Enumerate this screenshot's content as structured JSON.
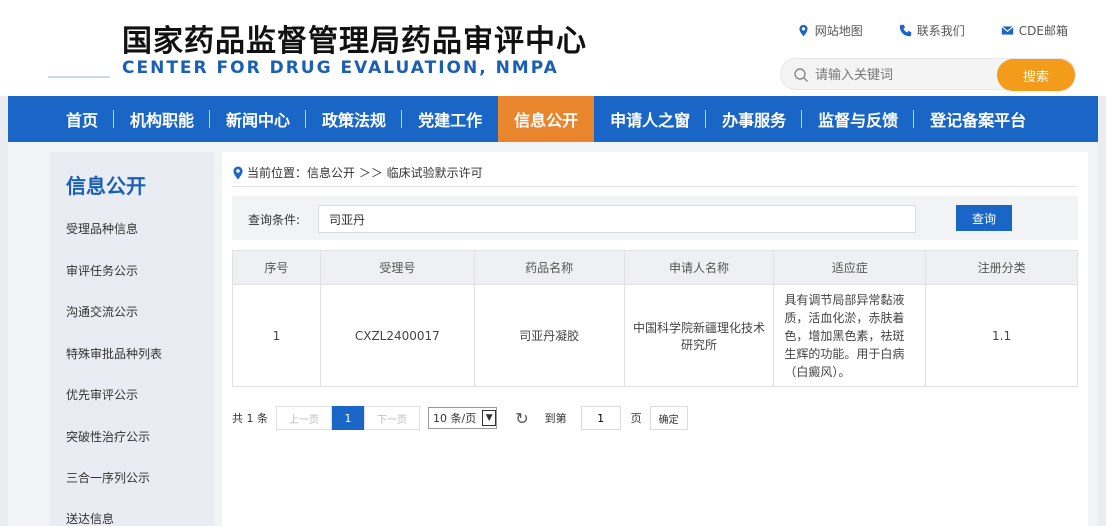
{
  "header": {
    "title_cn": "国家药品监督管理局药品审评中心",
    "title_en": "CENTER FOR DRUG EVALUATION, NMPA",
    "links": [
      {
        "icon": "location-pin-icon",
        "label": "网站地图"
      },
      {
        "icon": "phone-icon",
        "label": "联系我们"
      },
      {
        "icon": "mail-icon",
        "label": "CDE邮箱"
      }
    ],
    "search": {
      "placeholder": "请输入关键词",
      "button": "搜索"
    }
  },
  "nav": {
    "items": [
      "首页",
      "机构职能",
      "新闻中心",
      "政策法规",
      "党建工作",
      "信息公开",
      "申请人之窗",
      "办事服务",
      "监督与反馈",
      "登记备案平台"
    ],
    "active": "信息公开"
  },
  "sidebar": {
    "title": "信息公开",
    "items": [
      "受理品种信息",
      "审评任务公示",
      "沟通交流公示",
      "特殊审批品种列表",
      "优先审评公示",
      "突破性治疗公示",
      "三合一序列公示",
      "送达信息"
    ]
  },
  "main": {
    "breadcrumb": "当前位置：信息公开 ＞＞ 临床试验默示许可",
    "query": {
      "label": "查询条件:",
      "value": "司亚丹",
      "button": "查询"
    },
    "table": {
      "headers": [
        "序号",
        "受理号",
        "药品名称",
        "申请人名称",
        "适应症",
        "注册分类"
      ],
      "rows": [
        [
          "1",
          "CXZL2400017",
          "司亚丹凝胶",
          "中国科学院新疆理化技术研究所",
          "具有调节局部异常黏液质，活血化淤，赤肤着色，增加黑色素，祛斑生辉的功能。用于白病（白癜风）。",
          "1.1"
        ]
      ]
    },
    "pager": {
      "total": "共 1 条",
      "prev": "上一页",
      "current": "1",
      "next": "下一页",
      "page_size": "10 条/页",
      "goto_label": "到第",
      "goto_value": "1",
      "page_unit": "页",
      "confirm": "确定"
    }
  },
  "colors": {
    "brand_blue": "#1a66c6",
    "active_orange": "#e9852d",
    "search_orange": "#f39b1b"
  }
}
